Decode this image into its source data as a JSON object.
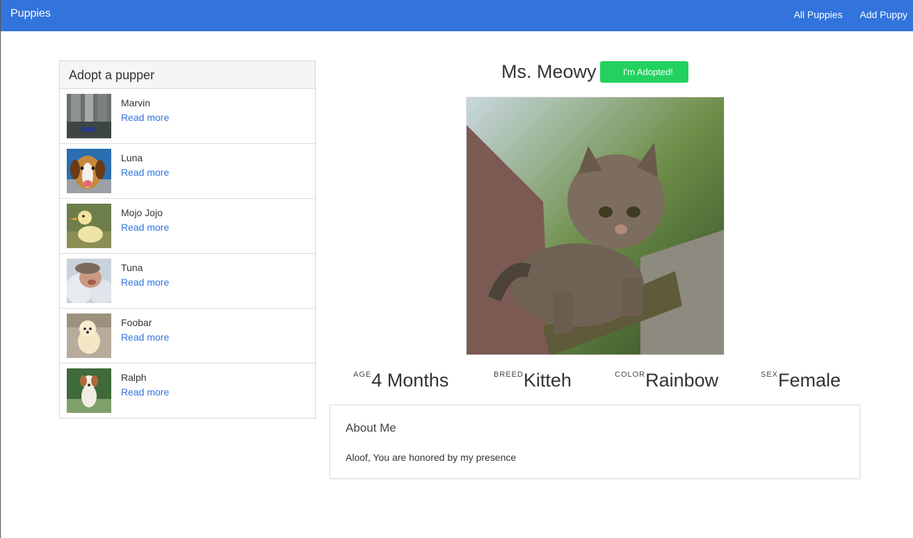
{
  "navbar": {
    "brand": "Puppies",
    "links": [
      "All Puppies",
      "Add Puppy"
    ],
    "color": "#3273dc"
  },
  "sidebar": {
    "title": "Adopt a pupper",
    "read_more_label": "Read more",
    "items": [
      {
        "name": "Marvin",
        "read_more": "Read more"
      },
      {
        "name": "Luna",
        "read_more": "Read more"
      },
      {
        "name": "Mojo Jojo",
        "read_more": "Read more"
      },
      {
        "name": "Tuna",
        "read_more": "Read more"
      },
      {
        "name": "Foobar",
        "read_more": "Read more"
      },
      {
        "name": "Ralph",
        "read_more": "Read more"
      }
    ]
  },
  "detail": {
    "name": "Ms. Meowy",
    "adopt_button": "I'm Adopted!",
    "adopt_color": "#23d160",
    "stats": [
      {
        "label": "AGE",
        "value": "4 Months"
      },
      {
        "label": "BREED",
        "value": "Kitteh"
      },
      {
        "label": "COLOR",
        "value": "Rainbow"
      },
      {
        "label": "SEX",
        "value": "Female"
      }
    ],
    "about_title": "About Me",
    "about_text": "Aloof, You are honored by my presence"
  }
}
